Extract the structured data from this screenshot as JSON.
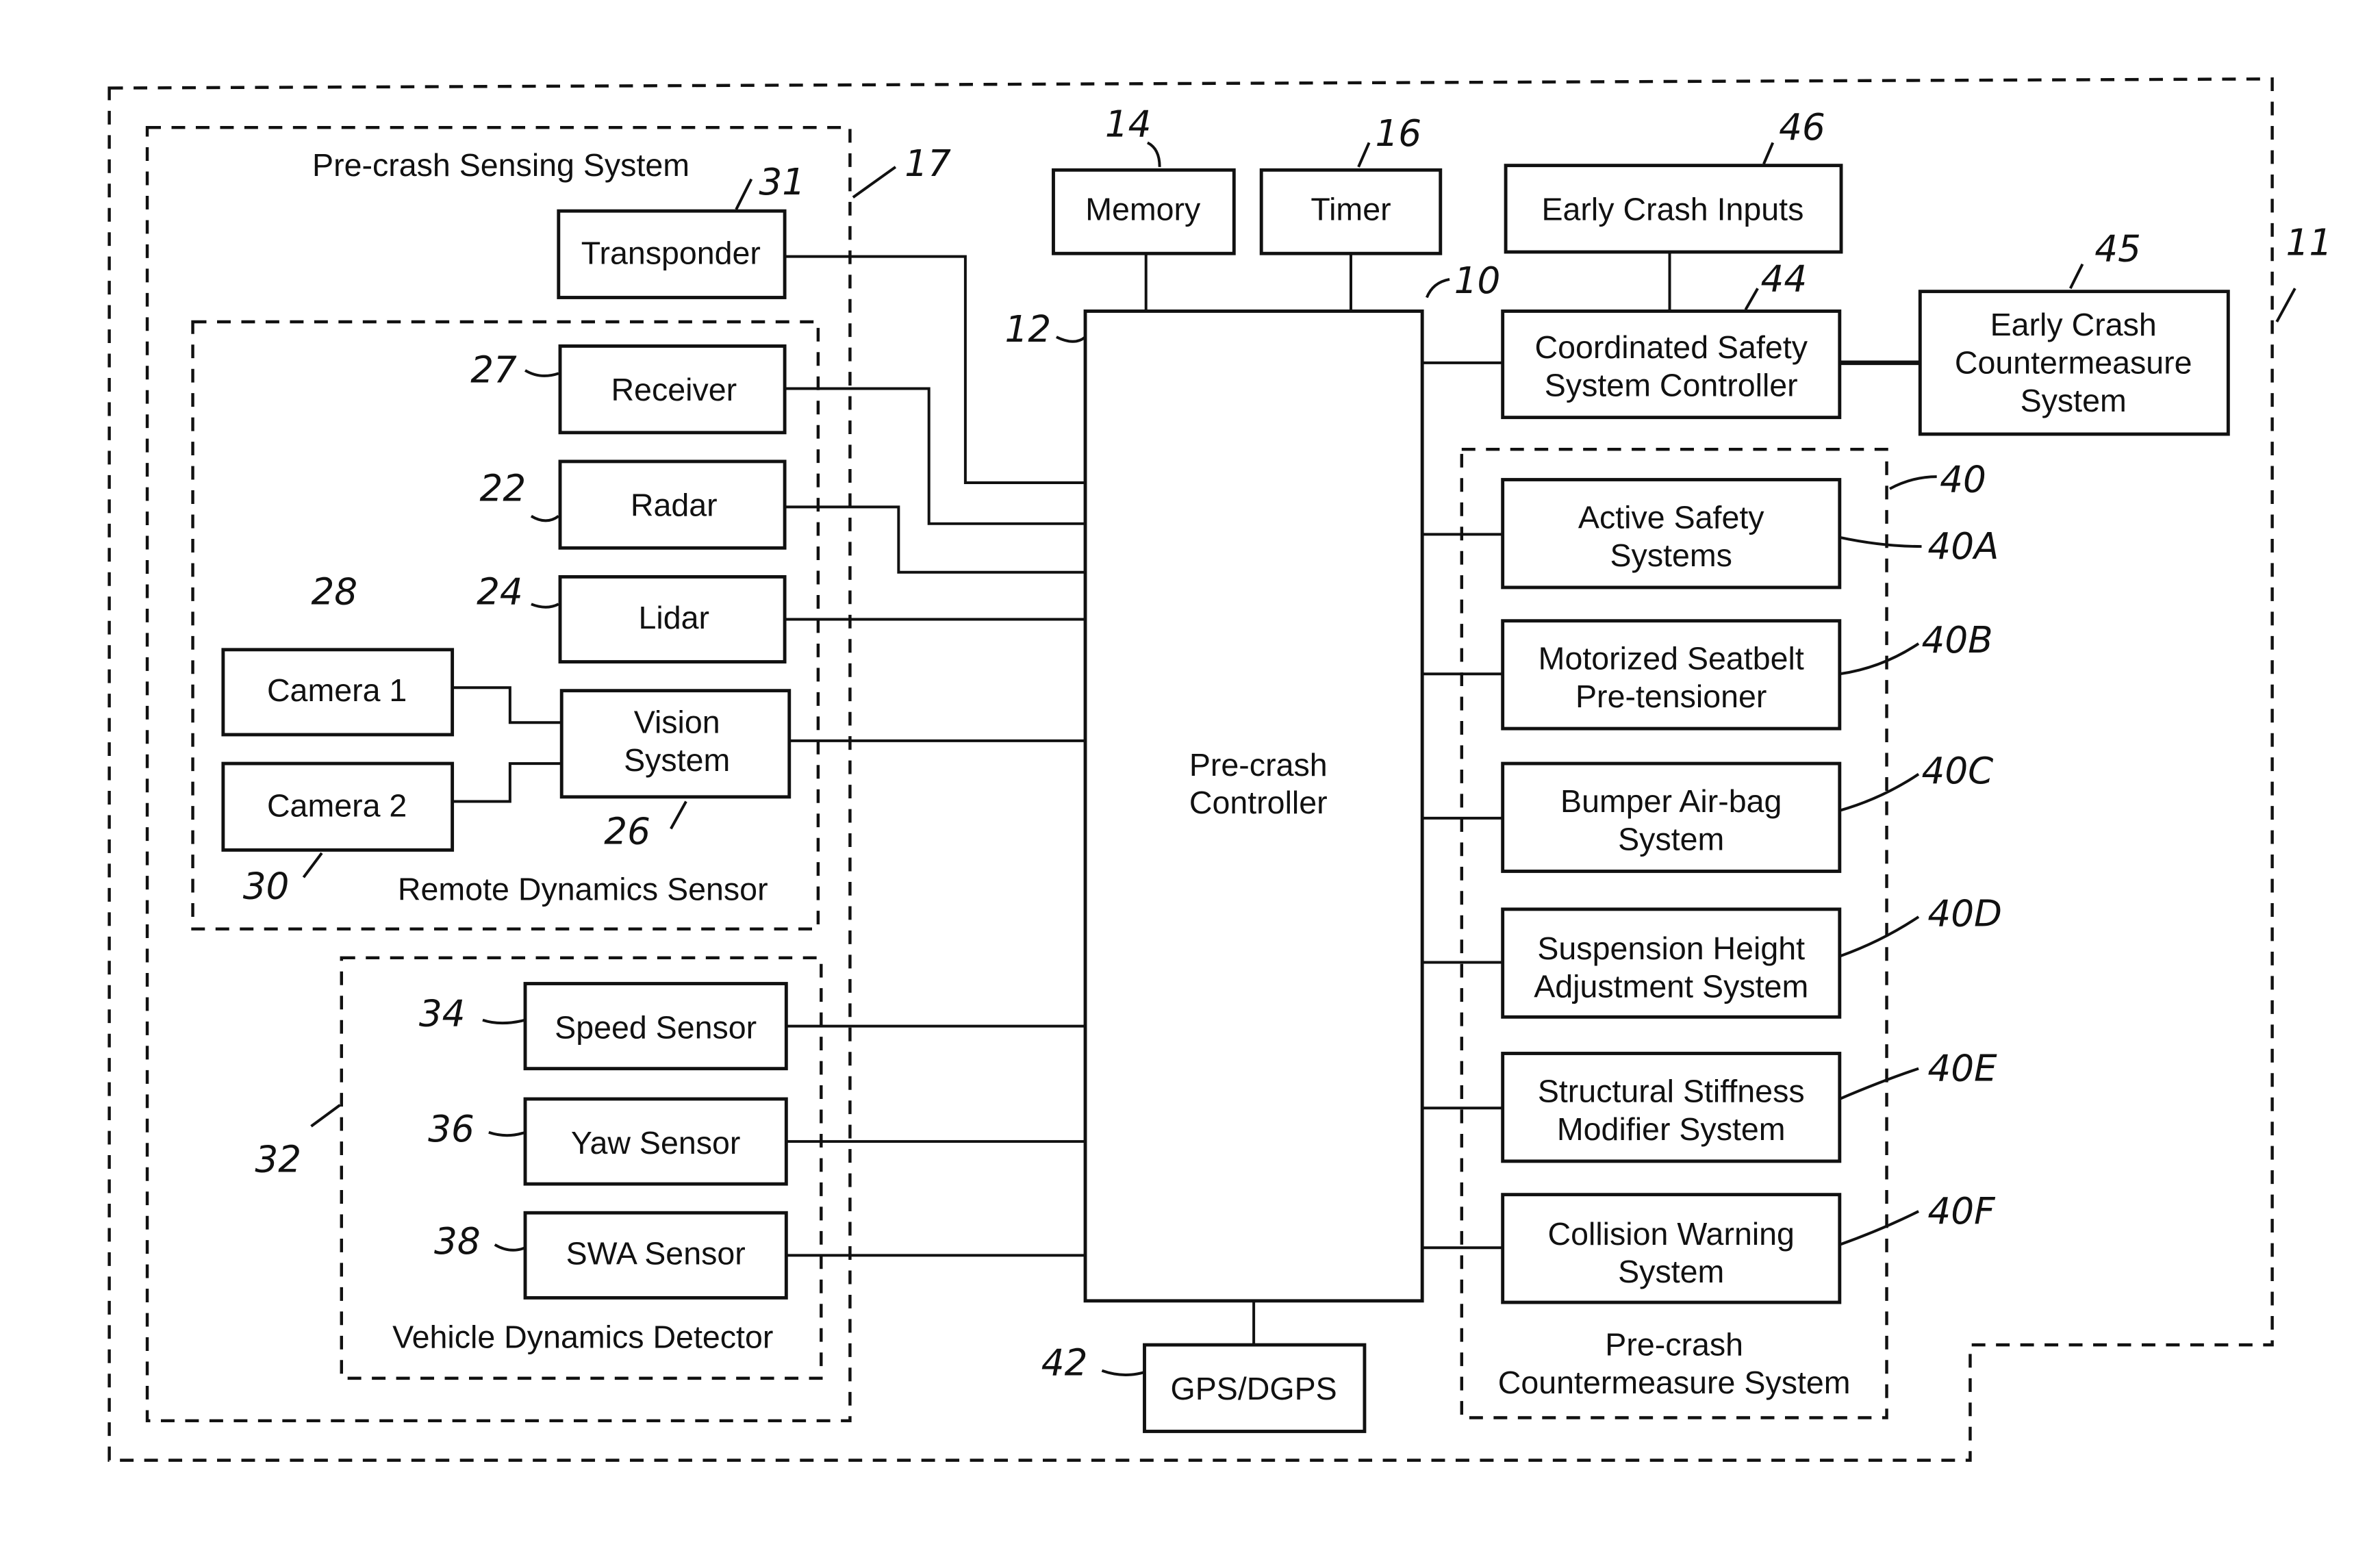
{
  "diagram": {
    "groups": {
      "overall_ref": "11",
      "sensing_system": {
        "title": "Pre-crash Sensing System",
        "ref": "17"
      },
      "remote_dynamics": {
        "title": "Remote Dynamics Sensor",
        "ref": "28"
      },
      "vehicle_dynamics": {
        "title": "Vehicle Dynamics Detector",
        "ref": "32"
      },
      "countermeasure": {
        "title_line1": "Pre-crash",
        "title_line2": "Countermeasure System",
        "ref": "40"
      }
    },
    "blocks": {
      "transponder": {
        "label": "Transponder",
        "ref": "31"
      },
      "receiver": {
        "label": "Receiver",
        "ref": "27"
      },
      "radar": {
        "label": "Radar",
        "ref": "22"
      },
      "lidar": {
        "label": "Lidar",
        "ref": "24"
      },
      "camera1": {
        "label": "Camera 1"
      },
      "camera2": {
        "label": "Camera 2",
        "ref": "30"
      },
      "vision": {
        "line1": "Vision",
        "line2": "System",
        "ref": "26"
      },
      "speed": {
        "label": "Speed Sensor",
        "ref": "34"
      },
      "yaw": {
        "label": "Yaw Sensor",
        "ref": "36"
      },
      "swa": {
        "label": "SWA Sensor",
        "ref": "38"
      },
      "memory": {
        "label": "Memory",
        "ref": "14"
      },
      "timer": {
        "label": "Timer",
        "ref": "16"
      },
      "controller": {
        "line1": "Pre-crash",
        "line2": "Controller",
        "ref": "12",
        "system_ref": "10"
      },
      "gps": {
        "label": "GPS/DGPS",
        "ref": "42"
      },
      "early_inputs": {
        "label": "Early Crash Inputs",
        "ref": "46"
      },
      "coordinated": {
        "line1": "Coordinated Safety",
        "line2": "System Controller",
        "ref": "44"
      },
      "early_cm": {
        "line1": "Early Crash",
        "line2": "Countermeasure",
        "line3": "System",
        "ref": "45"
      },
      "active": {
        "line1": "Active Safety",
        "line2": "Systems",
        "ref": "40A"
      },
      "seatbelt": {
        "line1": "Motorized Seatbelt",
        "line2": "Pre-tensioner",
        "ref": "40B"
      },
      "airbag": {
        "line1": "Bumper Air-bag",
        "line2": "System",
        "ref": "40C"
      },
      "suspension": {
        "line1": "Suspension Height",
        "line2": "Adjustment System",
        "ref": "40D"
      },
      "stiffness": {
        "line1": "Structural Stiffness",
        "line2": "Modifier System",
        "ref": "40E"
      },
      "warning": {
        "line1": "Collision Warning",
        "line2": "System",
        "ref": "40F"
      }
    }
  }
}
